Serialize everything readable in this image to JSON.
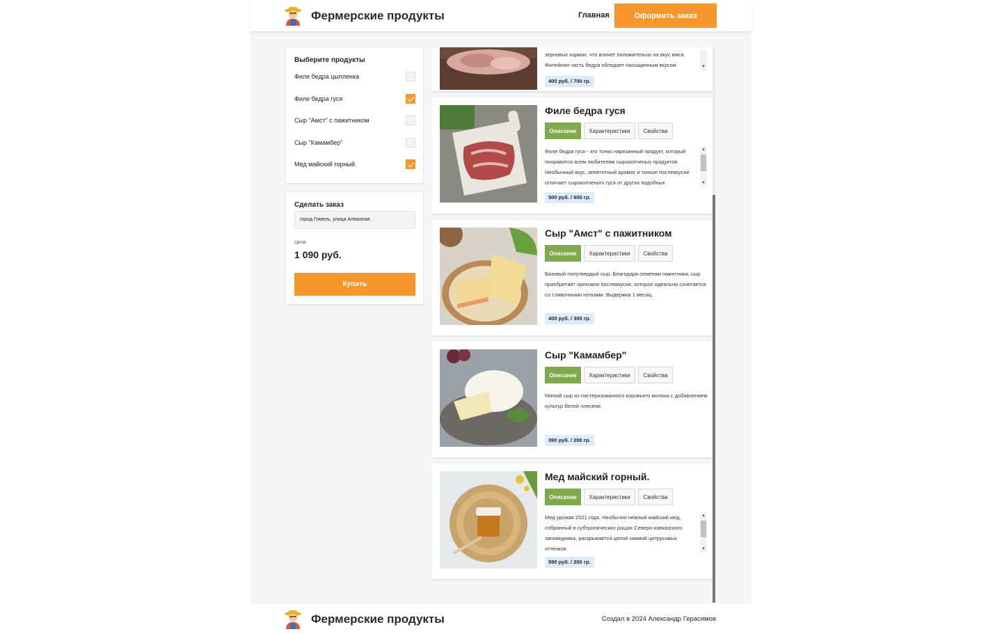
{
  "header": {
    "brand": "Фермерские продукты",
    "nav_home": "Главная",
    "order_button": "Оформить заказ"
  },
  "select_panel": {
    "title": "Выберите продукты",
    "items": [
      {
        "label": "Филе бедра цыпленка",
        "checked": false
      },
      {
        "label": "Филе бедра гуся",
        "checked": true
      },
      {
        "label": "Сыр \"Амст\" с пажитником",
        "checked": false
      },
      {
        "label": "Сыр \"Камамбер\"",
        "checked": false
      },
      {
        "label": "Мед майский горный.",
        "checked": true
      }
    ]
  },
  "order_panel": {
    "title": "Сделать заказ",
    "address_value": "город Гомель, улица Алмазная",
    "price_label": "Цена",
    "price_value": "1 090 руб.",
    "buy_button": "Купить"
  },
  "tabs": {
    "description": "Описание",
    "characteristics": "Характеристики",
    "properties": "Свойства"
  },
  "products": [
    {
      "title": "",
      "description": "зерновых кормах, что влияет положительно на вкус мяса. Филейная часть бедра обладает насыщенным вкусом",
      "price": "400 руб. / 700 гр."
    },
    {
      "title": "Филе бедра гуся",
      "description": "Филе бедра гуся - это тонко нарезанный продукт, который понравится всем любителям сырокопченых продуктов. Необычный вкус, аппетитный аромат и тонкое послевкусие отличает сырокопченого гуся от других подобных",
      "price": "500 руб. / 600 гр."
    },
    {
      "title": "Сыр \"Амст\" с пажитником",
      "description": "Базовый полутвердый сыр. Благодаря семенам пажитника, сыр приобретает ореховое послевкусие, которое идеально сочетается со сливочными нотками. Выдержка 1 месяц.",
      "price": "400 руб. / 300 гр."
    },
    {
      "title": "Сыр \"Камамбер\"",
      "description": "Мягкий сыр из пастеризованного коровьего молока с добавлением культур белой плесени.",
      "price": "390 руб. / 200 гр."
    },
    {
      "title": "Мед майский горный.",
      "description": "Мед урожая 2021 года. Необычно нежный майский мед, собранный в субтропических рощах Северо-кавказского заповедника, раскрывается целой гаммой цитрусовых оттенков.",
      "price": "590 руб. / 200 гр."
    }
  ],
  "footer": {
    "brand": "Фермерские продукты",
    "credit": "Создал в 2024 Александр Герасимов"
  },
  "colors": {
    "accent_orange": "#f7962a",
    "tab_active_green": "#7faa4b",
    "price_badge": "#dcecfb"
  },
  "icons": {
    "logo": "farmer-icon"
  }
}
